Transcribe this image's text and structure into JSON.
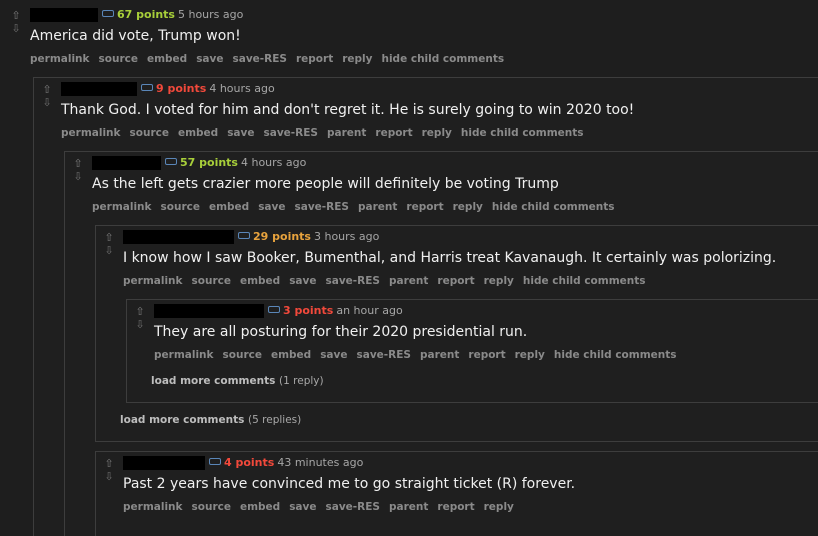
{
  "colors": {
    "points_green": "#a8cf3a",
    "points_red": "#f2493b",
    "points_orange": "#e8a33d",
    "tag_blue": "#5a86b8"
  },
  "comments": [
    {
      "points": "67 points",
      "age": "5 hours ago",
      "body": "America did vote, Trump won!",
      "buttons": [
        "permalink",
        "source",
        "embed",
        "save",
        "save-RES",
        "report",
        "reply",
        "hide child comments"
      ]
    },
    {
      "points": "9 points",
      "age": "4 hours ago",
      "body": "Thank God. I voted for him and don't regret it. He is surely going to win 2020 too!",
      "buttons": [
        "permalink",
        "source",
        "embed",
        "save",
        "save-RES",
        "parent",
        "report",
        "reply",
        "hide child comments"
      ]
    },
    {
      "points": "57 points",
      "age": "4 hours ago",
      "body": "As the left gets crazier more people will definitely be voting Trump",
      "buttons": [
        "permalink",
        "source",
        "embed",
        "save",
        "save-RES",
        "parent",
        "report",
        "reply",
        "hide child comments"
      ]
    },
    {
      "points": "29 points",
      "age": "3 hours ago",
      "body": "I know how I saw Booker, Bumenthal, and Harris treat Kavanaugh. It certainly was polorizing.",
      "buttons": [
        "permalink",
        "source",
        "embed",
        "save",
        "save-RES",
        "parent",
        "report",
        "reply",
        "hide child comments"
      ]
    },
    {
      "points": "3 points",
      "age": "an hour ago",
      "body": "They are all posturing for their 2020 presidential run.",
      "buttons": [
        "permalink",
        "source",
        "embed",
        "save",
        "save-RES",
        "parent",
        "report",
        "reply",
        "hide child comments"
      ]
    },
    {
      "points": "4 points",
      "age": "43 minutes ago",
      "body": "Past 2 years have convinced me to go straight ticket (R) forever.",
      "buttons": [
        "permalink",
        "source",
        "embed",
        "save",
        "save-RES",
        "parent",
        "report",
        "reply"
      ]
    }
  ],
  "load_more": [
    {
      "label": "load more comments",
      "count": "(1 reply)"
    },
    {
      "label": "load more comments",
      "count": "(5 replies)"
    }
  ]
}
